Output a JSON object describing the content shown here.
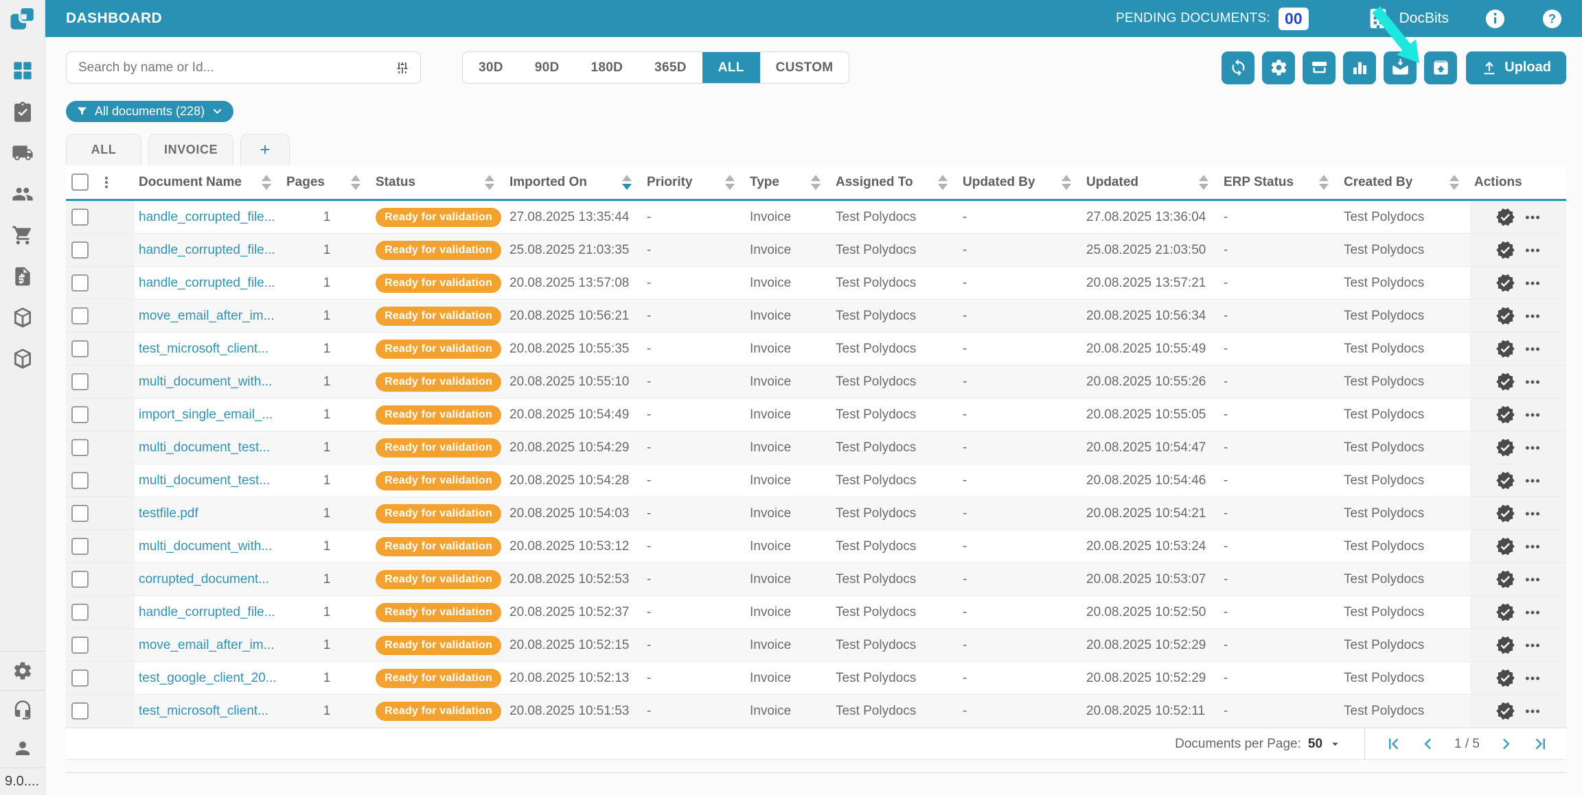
{
  "app": {
    "version": "9.0...."
  },
  "colors": {
    "primary": "#2992b4",
    "status_badge": "#f4a22f",
    "link": "#2e93b6",
    "pending_count_text": "#2946cf",
    "annotation_arrow": "#1ce8e0"
  },
  "sidebar": {
    "items": [
      {
        "icon": "dashboard-grid-icon",
        "id": "dashboard",
        "active": true
      },
      {
        "icon": "clipboard-check-icon",
        "id": "tasks",
        "active": false
      },
      {
        "icon": "truck-icon",
        "id": "shipping",
        "active": false
      },
      {
        "icon": "users-icon",
        "id": "users",
        "active": false
      },
      {
        "icon": "cart-icon",
        "id": "purchase",
        "active": false
      },
      {
        "icon": "invoice-icon",
        "id": "invoices",
        "active": false
      },
      {
        "icon": "package-icon",
        "id": "packages",
        "active": false
      },
      {
        "icon": "package-icon",
        "id": "products",
        "active": false
      }
    ],
    "bottom_items": [
      {
        "icon": "gear-icon",
        "id": "settings"
      },
      {
        "icon": "headset-icon",
        "id": "support"
      },
      {
        "icon": "user-icon",
        "id": "profile"
      }
    ]
  },
  "topbar": {
    "title": "DASHBOARD",
    "pending_label": "PENDING DOCUMENTS:",
    "pending_count": "00",
    "brand": "DocBits",
    "icons": {
      "building": "building-icon",
      "info": "info-icon",
      "help": "help-icon"
    }
  },
  "search": {
    "placeholder": "Search by name or Id...",
    "icon": "sliders-icon"
  },
  "date_filters": {
    "options": [
      "30D",
      "90D",
      "180D",
      "365D",
      "ALL",
      "CUSTOM"
    ],
    "active": "ALL"
  },
  "toolbar": {
    "buttons": [
      {
        "icon": "sync-icon",
        "id": "refresh"
      },
      {
        "icon": "gear-icon",
        "id": "settings"
      },
      {
        "icon": "scanner-icon",
        "id": "scan"
      },
      {
        "icon": "bar-chart-icon",
        "id": "analytics"
      },
      {
        "icon": "mail-download-icon",
        "id": "import-mail"
      },
      {
        "icon": "box-upload-icon",
        "id": "export"
      }
    ],
    "upload": {
      "icon": "upload-icon",
      "label": "Upload"
    }
  },
  "filter_chip": {
    "icon": "funnel-icon",
    "label": "All documents (228)",
    "chevron": "chevron-down-icon"
  },
  "tabs": [
    {
      "label": "ALL",
      "add": false
    },
    {
      "label": "INVOICE",
      "add": false
    },
    {
      "label": "+",
      "add": true
    }
  ],
  "table": {
    "columns": [
      {
        "label": "Document Name",
        "sortable": true,
        "sort": null
      },
      {
        "label": "Pages",
        "sortable": true,
        "sort": null
      },
      {
        "label": "Status",
        "sortable": true,
        "sort": null
      },
      {
        "label": "Imported On",
        "sortable": true,
        "sort": "desc"
      },
      {
        "label": "Priority",
        "sortable": true,
        "sort": null
      },
      {
        "label": "Type",
        "sortable": true,
        "sort": null
      },
      {
        "label": "Assigned To",
        "sortable": true,
        "sort": null
      },
      {
        "label": "Updated By",
        "sortable": true,
        "sort": null
      },
      {
        "label": "Updated",
        "sortable": true,
        "sort": null
      },
      {
        "label": "ERP Status",
        "sortable": true,
        "sort": null
      },
      {
        "label": "Created By",
        "sortable": true,
        "sort": null
      },
      {
        "label": "Actions",
        "sortable": false,
        "sort": null
      }
    ],
    "row_action_icons": [
      "badge-check-icon",
      "more-horizontal-icon"
    ],
    "rows": [
      {
        "name": "handle_corrupted_file...",
        "pages": "1",
        "status": "Ready for validation",
        "imported_on": "27.08.2025 13:35:44",
        "priority": "-",
        "type": "Invoice",
        "assigned_to": "Test Polydocs",
        "updated_by": "-",
        "updated": "27.08.2025 13:36:04",
        "erp_status": "-",
        "created_by": "Test Polydocs"
      },
      {
        "name": "handle_corrupted_file...",
        "pages": "1",
        "status": "Ready for validation",
        "imported_on": "25.08.2025 21:03:35",
        "priority": "-",
        "type": "Invoice",
        "assigned_to": "Test Polydocs",
        "updated_by": "-",
        "updated": "25.08.2025 21:03:50",
        "erp_status": "-",
        "created_by": "Test Polydocs"
      },
      {
        "name": "handle_corrupted_file...",
        "pages": "1",
        "status": "Ready for validation",
        "imported_on": "20.08.2025 13:57:08",
        "priority": "-",
        "type": "Invoice",
        "assigned_to": "Test Polydocs",
        "updated_by": "-",
        "updated": "20.08.2025 13:57:21",
        "erp_status": "-",
        "created_by": "Test Polydocs"
      },
      {
        "name": "move_email_after_im...",
        "pages": "1",
        "status": "Ready for validation",
        "imported_on": "20.08.2025 10:56:21",
        "priority": "-",
        "type": "Invoice",
        "assigned_to": "Test Polydocs",
        "updated_by": "-",
        "updated": "20.08.2025 10:56:34",
        "erp_status": "-",
        "created_by": "Test Polydocs"
      },
      {
        "name": "test_microsoft_client...",
        "pages": "1",
        "status": "Ready for validation",
        "imported_on": "20.08.2025 10:55:35",
        "priority": "-",
        "type": "Invoice",
        "assigned_to": "Test Polydocs",
        "updated_by": "-",
        "updated": "20.08.2025 10:55:49",
        "erp_status": "-",
        "created_by": "Test Polydocs"
      },
      {
        "name": "multi_document_with...",
        "pages": "1",
        "status": "Ready for validation",
        "imported_on": "20.08.2025 10:55:10",
        "priority": "-",
        "type": "Invoice",
        "assigned_to": "Test Polydocs",
        "updated_by": "-",
        "updated": "20.08.2025 10:55:26",
        "erp_status": "-",
        "created_by": "Test Polydocs"
      },
      {
        "name": "import_single_email_...",
        "pages": "1",
        "status": "Ready for validation",
        "imported_on": "20.08.2025 10:54:49",
        "priority": "-",
        "type": "Invoice",
        "assigned_to": "Test Polydocs",
        "updated_by": "-",
        "updated": "20.08.2025 10:55:05",
        "erp_status": "-",
        "created_by": "Test Polydocs"
      },
      {
        "name": "multi_document_test...",
        "pages": "1",
        "status": "Ready for validation",
        "imported_on": "20.08.2025 10:54:29",
        "priority": "-",
        "type": "Invoice",
        "assigned_to": "Test Polydocs",
        "updated_by": "-",
        "updated": "20.08.2025 10:54:47",
        "erp_status": "-",
        "created_by": "Test Polydocs"
      },
      {
        "name": "multi_document_test...",
        "pages": "1",
        "status": "Ready for validation",
        "imported_on": "20.08.2025 10:54:28",
        "priority": "-",
        "type": "Invoice",
        "assigned_to": "Test Polydocs",
        "updated_by": "-",
        "updated": "20.08.2025 10:54:46",
        "erp_status": "-",
        "created_by": "Test Polydocs"
      },
      {
        "name": "testfile.pdf",
        "pages": "1",
        "status": "Ready for validation",
        "imported_on": "20.08.2025 10:54:03",
        "priority": "-",
        "type": "Invoice",
        "assigned_to": "Test Polydocs",
        "updated_by": "-",
        "updated": "20.08.2025 10:54:21",
        "erp_status": "-",
        "created_by": "Test Polydocs"
      },
      {
        "name": "multi_document_with...",
        "pages": "1",
        "status": "Ready for validation",
        "imported_on": "20.08.2025 10:53:12",
        "priority": "-",
        "type": "Invoice",
        "assigned_to": "Test Polydocs",
        "updated_by": "-",
        "updated": "20.08.2025 10:53:24",
        "erp_status": "-",
        "created_by": "Test Polydocs"
      },
      {
        "name": "corrupted_document...",
        "pages": "1",
        "status": "Ready for validation",
        "imported_on": "20.08.2025 10:52:53",
        "priority": "-",
        "type": "Invoice",
        "assigned_to": "Test Polydocs",
        "updated_by": "-",
        "updated": "20.08.2025 10:53:07",
        "erp_status": "-",
        "created_by": "Test Polydocs"
      },
      {
        "name": "handle_corrupted_file...",
        "pages": "1",
        "status": "Ready for validation",
        "imported_on": "20.08.2025 10:52:37",
        "priority": "-",
        "type": "Invoice",
        "assigned_to": "Test Polydocs",
        "updated_by": "-",
        "updated": "20.08.2025 10:52:50",
        "erp_status": "-",
        "created_by": "Test Polydocs"
      },
      {
        "name": "move_email_after_im...",
        "pages": "1",
        "status": "Ready for validation",
        "imported_on": "20.08.2025 10:52:15",
        "priority": "-",
        "type": "Invoice",
        "assigned_to": "Test Polydocs",
        "updated_by": "-",
        "updated": "20.08.2025 10:52:29",
        "erp_status": "-",
        "created_by": "Test Polydocs"
      },
      {
        "name": "test_google_client_20...",
        "pages": "1",
        "status": "Ready for validation",
        "imported_on": "20.08.2025 10:52:13",
        "priority": "-",
        "type": "Invoice",
        "assigned_to": "Test Polydocs",
        "updated_by": "-",
        "updated": "20.08.2025 10:52:29",
        "erp_status": "-",
        "created_by": "Test Polydocs"
      },
      {
        "name": "test_microsoft_client...",
        "pages": "1",
        "status": "Ready for validation",
        "imported_on": "20.08.2025 10:51:53",
        "priority": "-",
        "type": "Invoice",
        "assigned_to": "Test Polydocs",
        "updated_by": "-",
        "updated": "20.08.2025 10:52:11",
        "erp_status": "-",
        "created_by": "Test Polydocs"
      }
    ]
  },
  "pagination": {
    "per_page_label": "Documents per Page:",
    "per_page": "50",
    "page_indicator": "1 / 5",
    "icons": {
      "caret": "caret-down-icon",
      "first": "page-first-icon",
      "prev": "page-prev-icon",
      "next": "page-next-icon",
      "last": "page-last-icon"
    }
  },
  "annotation": {
    "type": "cursor-arrow",
    "target": "mail-download button"
  }
}
